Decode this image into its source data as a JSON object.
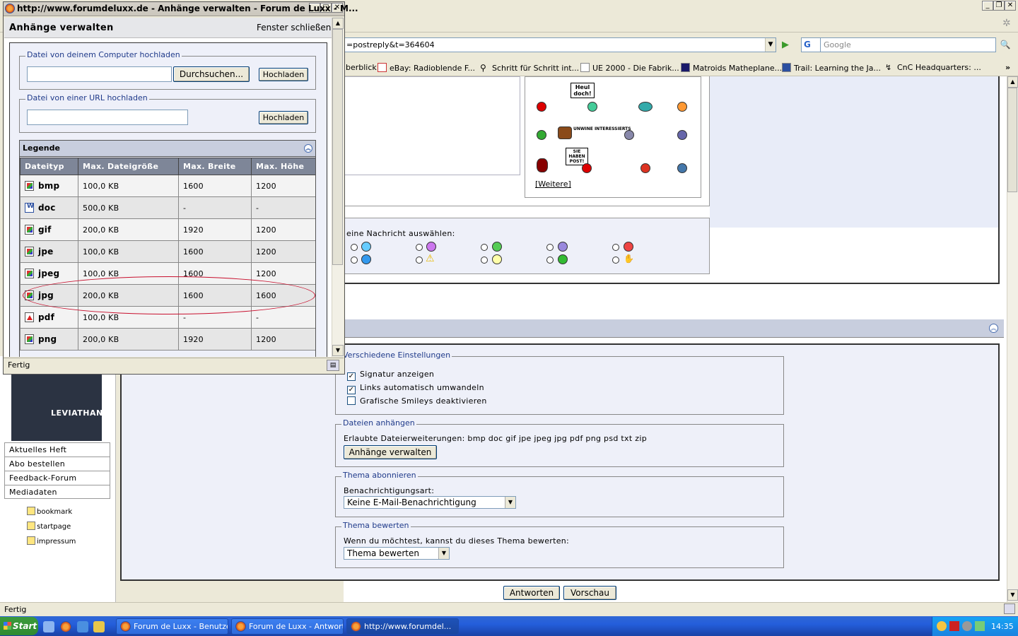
{
  "popup": {
    "window_title": "http://www.forumdeluxx.de - Anhänge verwalten - Forum de Luxx - M...",
    "heading": "Anhänge verwalten",
    "close_link": "Fenster schließen",
    "upload_computer": {
      "legend": "Datei von deinem Computer hochladen",
      "browse_label": "Durchsuchen...",
      "upload_label": "Hochladen",
      "file_value": ""
    },
    "upload_url": {
      "legend": "Datei von einer URL hochladen",
      "url_value": "",
      "upload_label": "Hochladen"
    },
    "legend_table": {
      "title": "Legende",
      "columns": [
        "Dateityp",
        "Max. Dateigröße",
        "Max. Breite",
        "Max. Höhe"
      ],
      "rows": [
        {
          "type": "bmp",
          "icon": "image-file-icon",
          "size": "100,0 KB",
          "width": "1600",
          "height": "1200"
        },
        {
          "type": "doc",
          "icon": "word-file-icon",
          "size": "500,0 KB",
          "width": "-",
          "height": "-"
        },
        {
          "type": "gif",
          "icon": "image-file-icon",
          "size": "200,0 KB",
          "width": "1920",
          "height": "1200"
        },
        {
          "type": "jpe",
          "icon": "image-file-icon",
          "size": "100,0 KB",
          "width": "1600",
          "height": "1200"
        },
        {
          "type": "jpeg",
          "icon": "image-file-icon",
          "size": "100,0 KB",
          "width": "1600",
          "height": "1200"
        },
        {
          "type": "jpg",
          "icon": "image-file-icon",
          "size": "200,0 KB",
          "width": "1600",
          "height": "1600"
        },
        {
          "type": "pdf",
          "icon": "pdf-file-icon",
          "size": "100,0 KB",
          "width": "-",
          "height": "-"
        },
        {
          "type": "png",
          "icon": "image-file-icon",
          "size": "200,0 KB",
          "width": "1920",
          "height": "1200"
        }
      ]
    },
    "status": "Fertig",
    "highlight_color": "#c8102e"
  },
  "browser": {
    "url": "=postreply&t=364604",
    "search_engine": "G",
    "search_placeholder": "Google",
    "bookmarks": [
      "berblick",
      "eBay: Radioblende F...",
      "Schritt für Schritt int...",
      "UE 2000 - Die Fabrik...",
      "Matroids Matheplane...",
      "Trail: Learning the Ja...",
      "CnC Headquarters: ..."
    ],
    "bookmarks_overflow": "»",
    "status": "Fertig"
  },
  "page": {
    "smileys_more": "[Weitere]",
    "sign_texts": [
      "Heul doch!",
      "UNWINE INTERESSIERTS",
      "SIE HABEN POST!"
    ],
    "message_icon_label": "eine Nachricht auswählen:",
    "settings": {
      "legend": "Verschiedene Einstellungen",
      "options": [
        {
          "label": "Signatur anzeigen",
          "checked": true
        },
        {
          "label": "Links automatisch umwandeln",
          "checked": true
        },
        {
          "label": "Grafische Smileys deaktivieren",
          "checked": false
        }
      ]
    },
    "attachments": {
      "legend": "Dateien anhängen",
      "allowed": "Erlaubte Dateierweiterungen: bmp doc gif jpe jpeg jpg pdf png psd txt zip",
      "button": "Anhänge verwalten"
    },
    "subscribe": {
      "legend": "Thema abonnieren",
      "label": "Benachrichtigungsart:",
      "selected": "Keine E-Mail-Benachrichtigung"
    },
    "rate": {
      "legend": "Thema bewerten",
      "label": "Wenn du möchtest, kannst du dieses Thema bewerten:",
      "selected": "Thema bewerten"
    },
    "reply_button": "Antworten",
    "preview_button": "Vorschau",
    "left_menu": [
      "Aktuelles Heft",
      "Abo bestellen",
      "Feedback-Forum",
      "Mediadaten"
    ],
    "left_links": [
      "bookmark",
      "startpage",
      "impressum"
    ],
    "ad_text": "LEVIATHAN"
  },
  "taskbar": {
    "start": "Start",
    "tasks": [
      "Forum de Luxx - Benutze...",
      "Forum de Luxx - Antwort...",
      "http://www.forumdel..."
    ],
    "clock": "14:35"
  }
}
